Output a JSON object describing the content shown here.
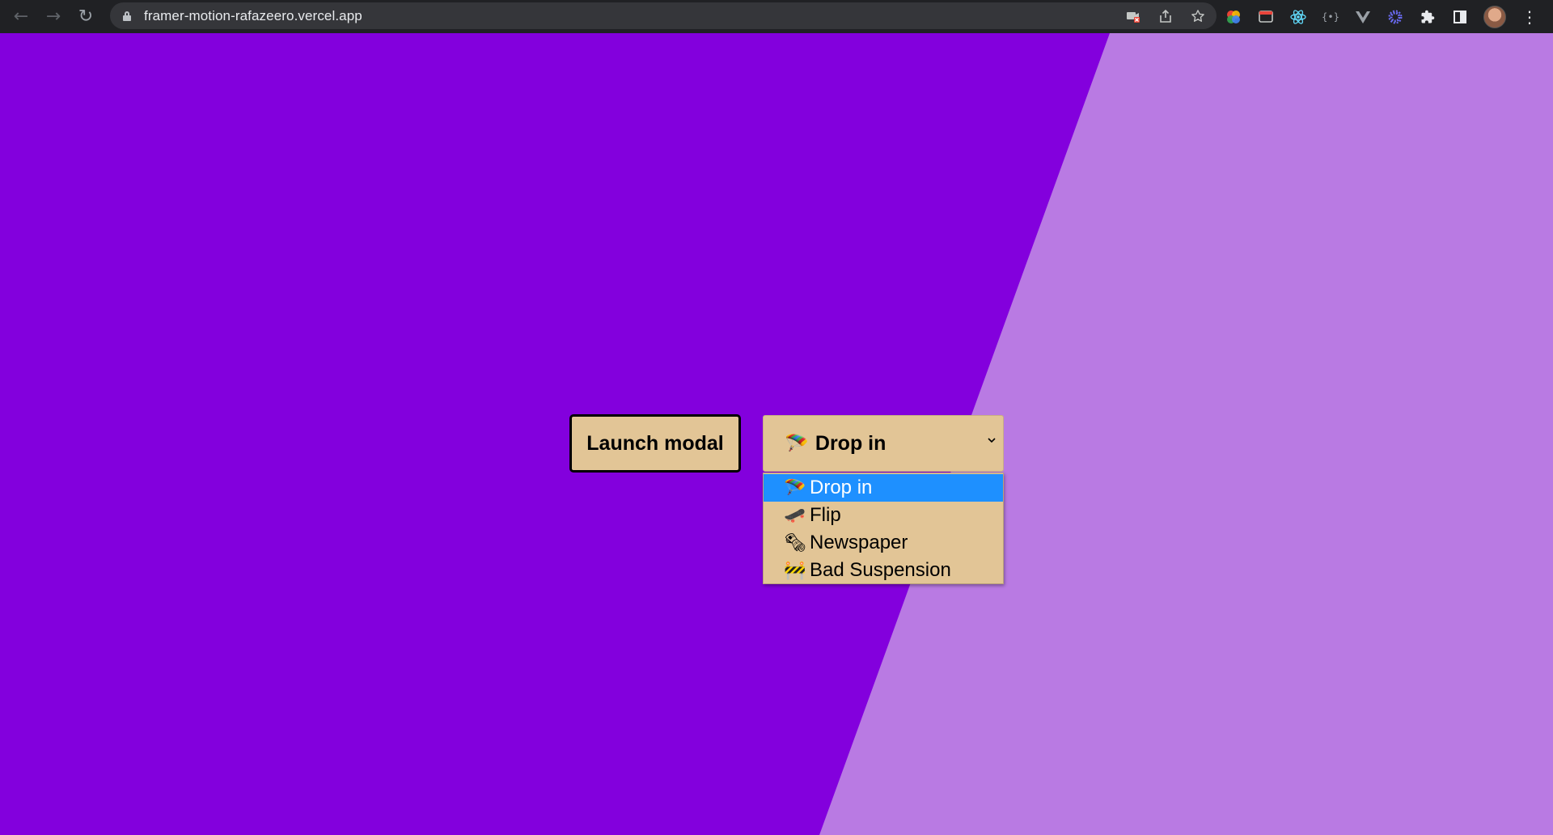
{
  "browser": {
    "url": "framer-motion-rafazeero.vercel.app",
    "nav_icons": [
      "back-icon",
      "forward-icon",
      "reload-icon"
    ],
    "omnibox_icons": [
      "camera-blocked-icon",
      "share-icon",
      "bookmark-star-icon"
    ],
    "extension_icons": [
      "color-picker-extension-icon",
      "window-extension-icon",
      "react-devtools-icon",
      "json-extension-icon",
      "vue-devtools-icon",
      "gear-extension-icon",
      "puzzle-extensions-icon",
      "side-panel-icon",
      "avatar",
      "kebab-menu-icon"
    ]
  },
  "page": {
    "launch_button_label": "Launch modal",
    "select": {
      "selected_emoji": "🪂",
      "selected_label": "Drop in",
      "options": [
        {
          "emoji": "🪂",
          "label": "Drop in",
          "selected": true
        },
        {
          "emoji": "🛹",
          "label": "Flip",
          "selected": false
        },
        {
          "emoji": "🗞",
          "label": "Newspaper",
          "selected": false
        },
        {
          "emoji": "🚧",
          "label": "Bad Suspension",
          "selected": false
        }
      ]
    },
    "colors": {
      "background_dark": "#8300dd",
      "background_light": "#b97ae3",
      "button_fill": "#e2c596",
      "option_highlight": "#1e90ff"
    }
  }
}
